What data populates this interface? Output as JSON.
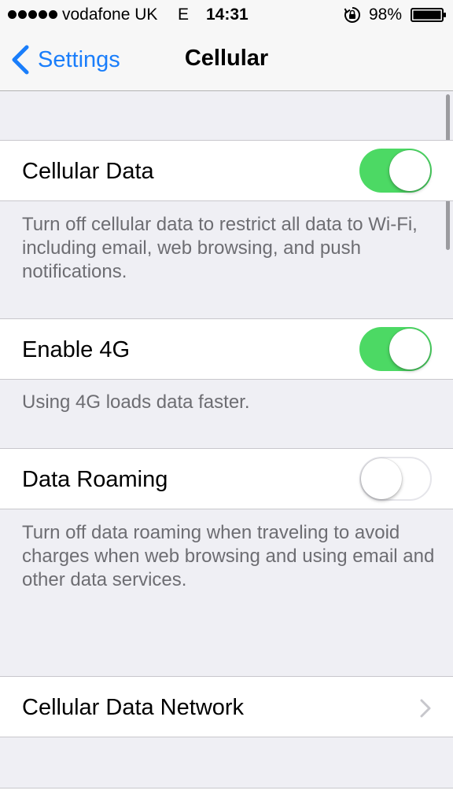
{
  "status_bar": {
    "carrier": "vodafone UK",
    "network": "E",
    "time": "14:31",
    "battery_percent": "98%",
    "signal_bars": 5,
    "icons": [
      "signal-dots-icon",
      "rotation-lock-icon",
      "battery-icon"
    ]
  },
  "nav": {
    "back_label": "Settings",
    "title": "Cellular",
    "accent_color": "#1a7efb"
  },
  "settings": {
    "cellular_data": {
      "label": "Cellular Data",
      "enabled": true,
      "footer": "Turn off cellular data to restrict all data to Wi-Fi, including email, web browsing, and push notifications."
    },
    "enable_4g": {
      "label": "Enable 4G",
      "enabled": true,
      "footer": "Using 4G loads data faster."
    },
    "data_roaming": {
      "label": "Data Roaming",
      "enabled": false,
      "footer": "Turn off data roaming when traveling to avoid charges when web browsing and using email and other data services."
    },
    "cellular_data_network": {
      "label": "Cellular Data Network",
      "icon": "chevron-right-icon"
    }
  },
  "colors": {
    "toggle_on": "#4cd964",
    "background": "#efeff4",
    "footer_text": "#6d6d72"
  }
}
